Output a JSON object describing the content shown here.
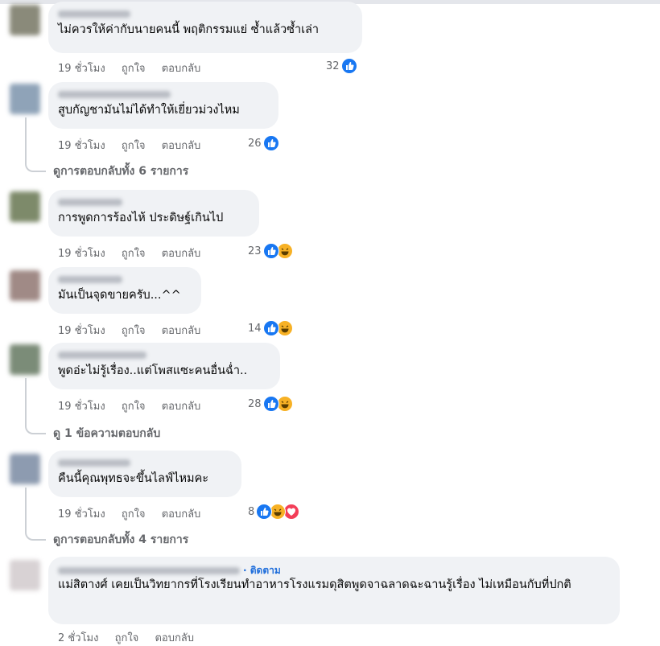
{
  "comments": [
    {
      "text": "ไม่ควรให้ค่ากับนายคนนี้ พฤติกรรมแย่ ซ้ำแล้วซ้ำเล่า",
      "time": "19 ชั่วโมง",
      "like": "ถูกใจ",
      "reply": "ตอบกลับ",
      "count": "32",
      "reactions": [
        "like"
      ],
      "avatar_color": "#8a8a7a"
    },
    {
      "text": "สูบกัญชามันไม่ได้ทำให้เยี่ยวม่วงไหม",
      "time": "19 ชั่วโมง",
      "like": "ถูกใจ",
      "reply": "ตอบกลับ",
      "count": "26",
      "reactions": [
        "like"
      ],
      "view_replies": "ดูการตอบกลับทั้ง 6 รายการ",
      "avatar_color": "#8fa3b8"
    },
    {
      "text": "การพูดการร้องไห้ ประดิษฐ์เกินไป",
      "time": "19 ชั่วโมง",
      "like": "ถูกใจ",
      "reply": "ตอบกลับ",
      "count": "23",
      "reactions": [
        "like",
        "haha"
      ],
      "avatar_color": "#7d8a6a"
    },
    {
      "text": "มันเป็นจุดขายครับ...^^",
      "time": "19 ชั่วโมง",
      "like": "ถูกใจ",
      "reply": "ตอบกลับ",
      "count": "14",
      "reactions": [
        "like",
        "haha"
      ],
      "avatar_color": "#a08a86"
    },
    {
      "text": "พูดอ่ะไม่รู้เรื่อง..แต่โพสแซะคนอื่นฉ่ำ..",
      "time": "19 ชั่วโมง",
      "like": "ถูกใจ",
      "reply": "ตอบกลับ",
      "count": "28",
      "reactions": [
        "like",
        "haha"
      ],
      "view_replies": "ดู 1 ข้อความตอบกลับ",
      "avatar_color": "#7b8c78"
    },
    {
      "text": "คืนนี้คุณพุทธจะขึ้นไลฟ์ไหมคะ",
      "time": "19 ชั่วโมง",
      "like": "ถูกใจ",
      "reply": "ตอบกลับ",
      "count": "8",
      "reactions": [
        "like",
        "haha",
        "love"
      ],
      "view_replies": "ดูการตอบกลับทั้ง 4 รายการ",
      "avatar_color": "#8d9bb0"
    },
    {
      "follow": "· ติดตาม",
      "text": "แม่สิตางศ์ เคยเป็นวิทยากรที่โรงเรียนทำอาหารโรงแรมดุสิตพูดจาฉลาดฉะฉานรู้เรื่อง ไม่เหมือนกับที่ปกติ",
      "time": "2 ชั่วโมง",
      "like": "ถูกใจ",
      "reply": "ตอบกลับ",
      "avatar_color": "#d8d2d4"
    }
  ],
  "colors": {
    "like": "#1877f2",
    "haha": "#f7b125",
    "love": "#f33e58",
    "link": "#216fdb"
  }
}
